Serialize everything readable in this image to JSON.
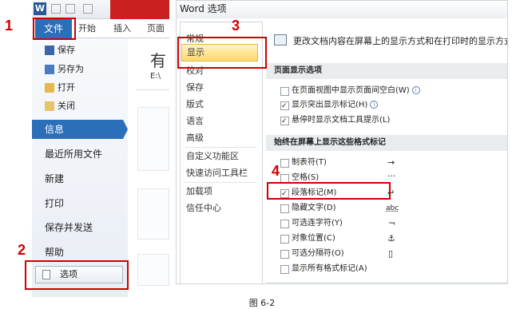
{
  "left": {
    "qat_logo": "W",
    "ribbon_tabs": [
      "文件",
      "开始",
      "插入",
      "页面"
    ],
    "nav_small": [
      {
        "label": "保存",
        "icon": "save-icon"
      },
      {
        "label": "另存为",
        "icon": "save-as-icon"
      },
      {
        "label": "打开",
        "icon": "open-folder-icon"
      },
      {
        "label": "关闭",
        "icon": "close-folder-icon"
      }
    ],
    "nav_selected": "信息",
    "nav_big": [
      "最近所用文件",
      "新建",
      "打印",
      "保存并发送",
      "帮助"
    ],
    "options_label": "选项",
    "content_title": "有",
    "content_path": "E:\\"
  },
  "dialog": {
    "title": "Word 选项",
    "categories": [
      "常规",
      "显示",
      "校对",
      "保存",
      "版式",
      "语言",
      "高级",
      "自定义功能区",
      "快速访问工具栏",
      "加载项",
      "信任中心"
    ],
    "intro": "更改文档内容在屏幕上的显示方式和在打印时的显示方式。",
    "section1": "页面显示选项",
    "section1_options": [
      {
        "label": "在页面视图中显示页面间空白(W)",
        "checked": false,
        "info": "i"
      },
      {
        "label": "显示突出显示标记(H)",
        "checked": true,
        "info": "i"
      },
      {
        "label": "悬停时显示文档工具提示(L)",
        "checked": true,
        "info": ""
      }
    ],
    "section2": "始终在屏幕上显示这些格式标记",
    "section2_options": [
      {
        "label": "制表符(T)",
        "checked": false,
        "symbol": "→"
      },
      {
        "label": "空格(S)",
        "checked": false,
        "symbol": "···"
      },
      {
        "label": "段落标记(M)",
        "checked": true,
        "symbol": "↵"
      },
      {
        "label": "隐藏文字(D)",
        "checked": false,
        "symbol": "abc"
      },
      {
        "label": "可选连字符(Y)",
        "checked": false,
        "symbol": "¬"
      },
      {
        "label": "对象位置(C)",
        "checked": false,
        "symbol": "⚓"
      },
      {
        "label": "可选分隔符(O)",
        "checked": false,
        "symbol": "▯"
      },
      {
        "label": "显示所有格式标记(A)",
        "checked": false,
        "symbol": ""
      }
    ]
  },
  "annotations": {
    "step1": "1",
    "step2": "2",
    "step3": "3",
    "step4": "4",
    "color": "#d00000"
  },
  "caption": "图 6-2"
}
